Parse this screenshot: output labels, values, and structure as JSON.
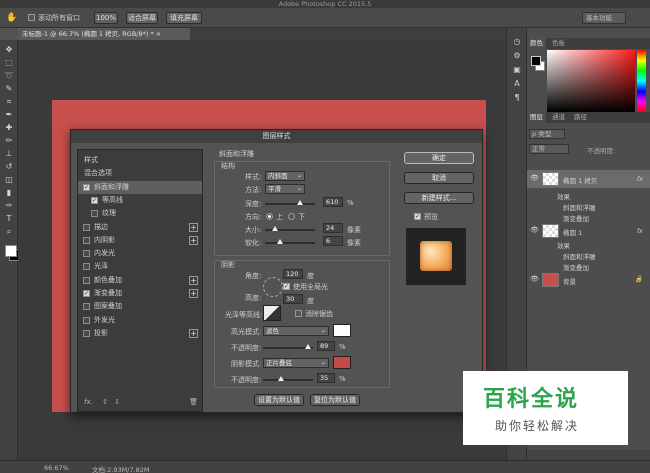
{
  "app": {
    "title": "Adobe Photoshop CC 2015.5"
  },
  "options": {
    "scroll_all_label": "滚动所有窗口",
    "zoom_value": "100%",
    "fit_screen": "适合屏幕",
    "fill_screen": "填充屏幕",
    "workspace": "基本功能"
  },
  "doc_tab": "未标题-1 @ 66.7% (椭圆 1 拷贝, RGB/8*) *  ×",
  "status": {
    "zoom": "66.67%",
    "doc_info": "文档:2.93M/7.82M"
  },
  "panels": {
    "color_tabs": [
      "颜色",
      "色板"
    ],
    "layer_tabs": [
      "图层",
      "通道",
      "路径"
    ],
    "kind_filter": "ρ 类型",
    "blend_mode": "正常",
    "opacity_label": "不透明度:",
    "layers": [
      {
        "name": "椭圆 1 拷贝",
        "fx": "fx",
        "effects_label": "效果",
        "effects": [
          "斜面和浮雕",
          "渐变叠加"
        ]
      },
      {
        "name": "椭圆 1",
        "fx": "fx",
        "effects_label": "效果",
        "effects": [
          "斜面和浮雕",
          "渐变叠加"
        ]
      },
      {
        "name": "背景"
      }
    ]
  },
  "dialog": {
    "title": "图层样式",
    "list": [
      {
        "label": "样式",
        "cb": null,
        "plus": false
      },
      {
        "label": "混合选项",
        "cb": null,
        "plus": false
      },
      {
        "label": "斜面和浮雕",
        "cb": true,
        "plus": false,
        "selected": true
      },
      {
        "label": "等高线",
        "cb": true,
        "plus": false,
        "indent": true
      },
      {
        "label": "纹理",
        "cb": false,
        "plus": false,
        "indent": true
      },
      {
        "label": "描边",
        "cb": false,
        "plus": true
      },
      {
        "label": "内阴影",
        "cb": false,
        "plus": true
      },
      {
        "label": "内发光",
        "cb": false,
        "plus": false
      },
      {
        "label": "光泽",
        "cb": false,
        "plus": false
      },
      {
        "label": "颜色叠加",
        "cb": false,
        "plus": true
      },
      {
        "label": "渐变叠加",
        "cb": true,
        "plus": true
      },
      {
        "label": "图案叠加",
        "cb": false,
        "plus": false
      },
      {
        "label": "外发光",
        "cb": false,
        "plus": false
      },
      {
        "label": "投影",
        "cb": false,
        "plus": true
      }
    ],
    "footer_fx": "fx.",
    "bevel": {
      "heading": "斜面和浮雕",
      "structure": "结构",
      "style_label": "样式:",
      "style_value": "内斜面",
      "technique_label": "方法:",
      "technique_value": "平滑",
      "depth_label": "深度:",
      "depth_value": "610",
      "depth_unit": "%",
      "depth_pct": 0.7,
      "direction_label": "方向:",
      "dir_up": "上",
      "dir_down": "下",
      "size_label": "大小:",
      "size_value": "24",
      "size_unit": "像素",
      "size_pct": 0.2,
      "soften_label": "软化:",
      "soften_value": "6",
      "soften_unit": "像素",
      "soften_pct": 0.3
    },
    "shading": {
      "heading": "阴影",
      "angle_label": "角度:",
      "angle_value": "120",
      "angle_unit": "度",
      "global_light": "使用全局光",
      "altitude_label": "高度:",
      "altitude_value": "30",
      "altitude_unit": "度",
      "gloss_label": "光泽等高线:",
      "anti_alias": "消除锯齿",
      "highlight_label": "高光模式:",
      "highlight_value": "滤色",
      "highlight_color": "#ffffff",
      "hl_opacity_label": "不透明度:",
      "hl_opacity_value": "89",
      "hl_opacity_unit": "%",
      "hl_opacity_pct": 0.89,
      "shadow_label": "阴影模式:",
      "shadow_value": "正片叠底",
      "shadow_color": "#c44a48",
      "sh_opacity_label": "不透明度:",
      "sh_opacity_value": "35",
      "sh_opacity_unit": "%",
      "sh_opacity_pct": 0.35
    },
    "make_default": "设置为默认值",
    "reset_default": "复位为默认值",
    "ok": "确定",
    "cancel": "取消",
    "new_style": "新建样式...",
    "preview_label": "预览"
  },
  "watermark": {
    "title": "百科全说",
    "subtitle": "助你轻松解决"
  }
}
